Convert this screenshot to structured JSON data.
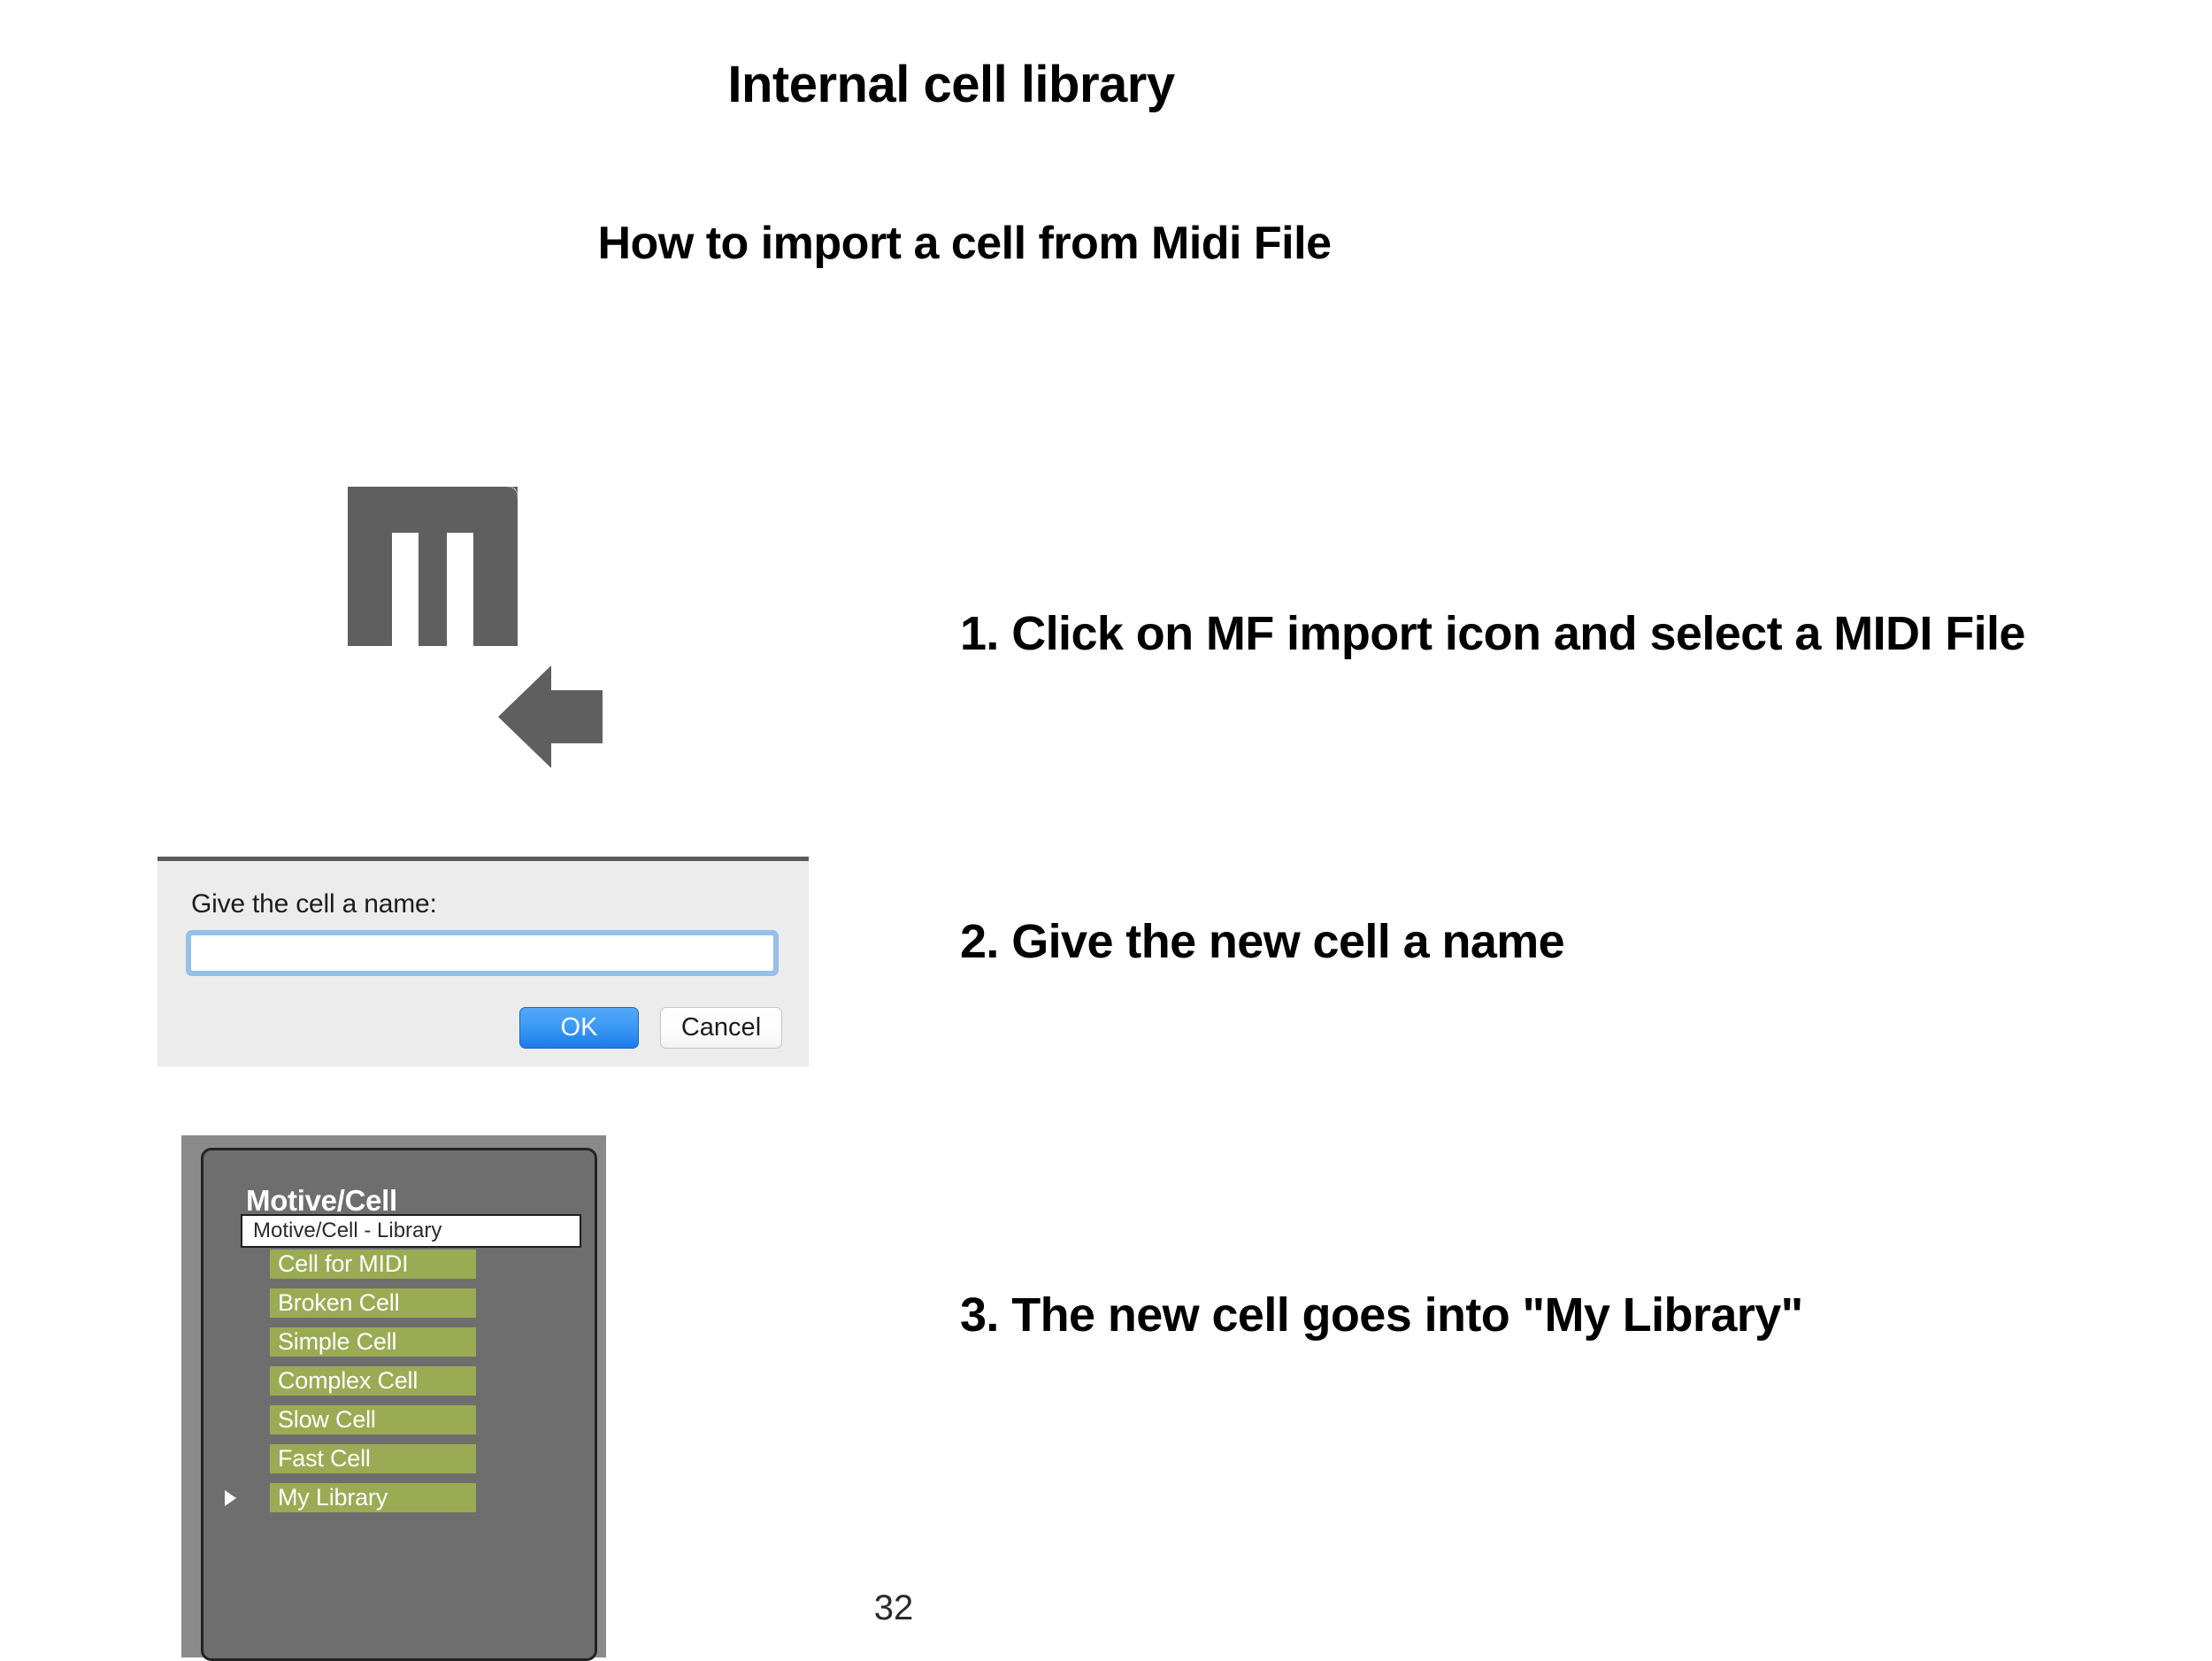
{
  "slide": {
    "title": "Internal cell library",
    "subtitle": "How to import a cell from Midi File",
    "page_number": "32"
  },
  "steps": [
    {
      "text": "1. Click on MF import icon and select a MIDI File"
    },
    {
      "text": "2. Give the new cell a name"
    },
    {
      "text": "3. The new cell goes into \"My Library\""
    }
  ],
  "mf_import_icon": {
    "glyph_letter": "m",
    "arrow_direction": "left",
    "color": "#5f5f5f"
  },
  "name_dialog": {
    "label": "Give the cell a name:",
    "input_value": "",
    "input_placeholder": "",
    "ok_label": "OK",
    "cancel_label": "Cancel",
    "accent_color": "#3d9bf5",
    "focus_ring_color": "#94c0ea",
    "background_color": "#ececec"
  },
  "library_panel": {
    "heading": "Motive/Cell",
    "search_text": "Motive/Cell  - Library",
    "panel_color": "#6e6e6e",
    "item_color": "#9bab53",
    "items": [
      {
        "label": "Cell for MIDI",
        "has_disclosure": false
      },
      {
        "label": "Broken Cell",
        "has_disclosure": false
      },
      {
        "label": "Simple Cell",
        "has_disclosure": false
      },
      {
        "label": "Complex Cell",
        "has_disclosure": false
      },
      {
        "label": "Slow Cell",
        "has_disclosure": false
      },
      {
        "label": "Fast Cell",
        "has_disclosure": false
      },
      {
        "label": "My Library",
        "has_disclosure": true
      }
    ]
  }
}
